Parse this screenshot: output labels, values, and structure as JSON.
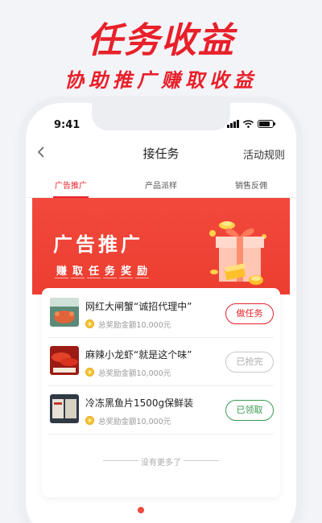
{
  "promo": {
    "title": "任务收益",
    "subtitle": "协助推广赚取收益"
  },
  "status_bar": {
    "time": "9:41"
  },
  "nav": {
    "back_icon": "chevron-left-icon",
    "title": "接任务",
    "rules_label": "活动规则"
  },
  "tabs": [
    {
      "label": "广告推广",
      "active": true
    },
    {
      "label": "产品派样",
      "active": false
    },
    {
      "label": "销售反佣",
      "active": false
    }
  ],
  "banner": {
    "title": "广告推广",
    "subtitle_chars": [
      "赚",
      "取",
      "任",
      "务",
      "奖",
      "励"
    ]
  },
  "tasks": [
    {
      "title": "网红大闸蟹“诚招代理中”",
      "reward_text": "总奖励金额10,000元",
      "button_label": "做任务",
      "button_state": "available"
    },
    {
      "title": "麻辣小龙虾“就是这个味”",
      "reward_text": "总奖励金额10,000元",
      "button_label": "已抢完",
      "button_state": "sold-out"
    },
    {
      "title": "冷冻黑鱼片1500g保鲜装",
      "reward_text": "总奖励金额10,000元",
      "button_label": "已领取",
      "button_state": "claimed"
    }
  ],
  "no_more_text": "没有更多了",
  "colors": {
    "accent": "#e8202a",
    "banner": "#ec3e31",
    "claimed": "#3a9a52",
    "disabled": "#c8c8c8"
  }
}
